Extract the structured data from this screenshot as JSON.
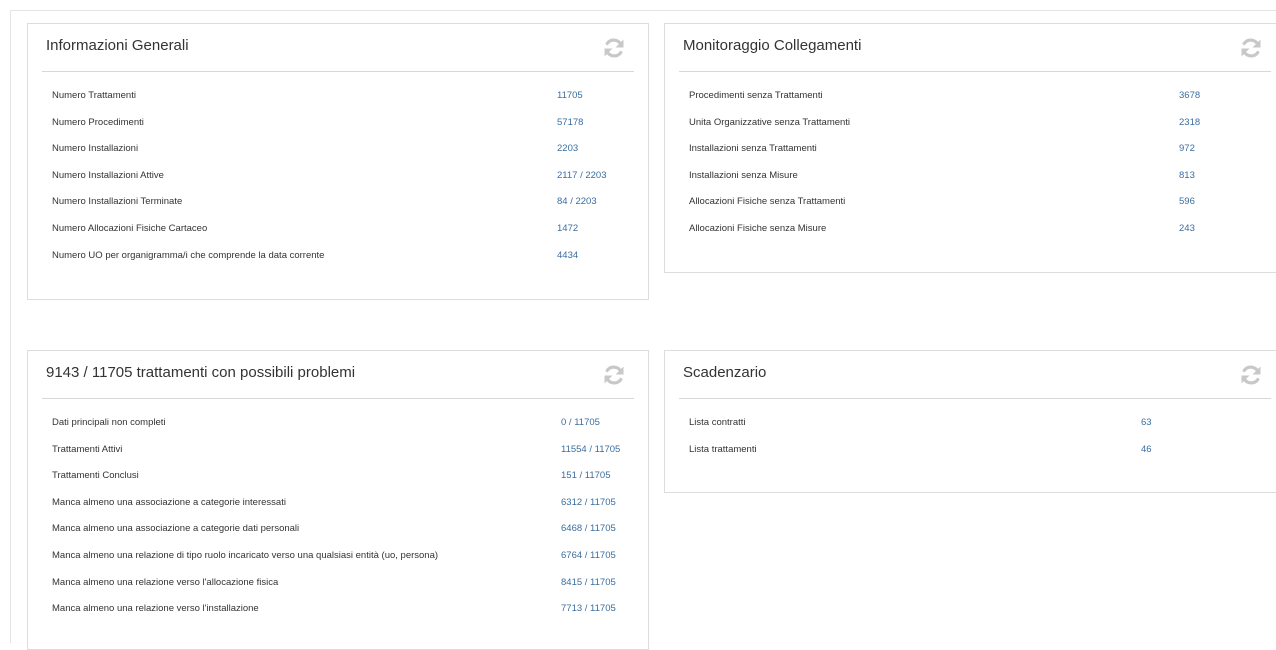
{
  "panels": {
    "info": {
      "title": "Informazioni Generali",
      "rows": [
        {
          "label": "Numero Trattamenti",
          "value": "11705"
        },
        {
          "label": "Numero Procedimenti",
          "value": "57178"
        },
        {
          "label": "Numero Installazioni",
          "value": "2203"
        },
        {
          "label": "Numero Installazioni Attive",
          "value": "2117 / 2203"
        },
        {
          "label": "Numero Installazioni Terminate",
          "value": "84 / 2203"
        },
        {
          "label": "Numero Allocazioni Fisiche Cartaceo",
          "value": "1472"
        },
        {
          "label": "Numero UO per organigramma/i che comprende la data corrente",
          "value": "4434"
        }
      ]
    },
    "monitor": {
      "title": "Monitoraggio Collegamenti",
      "rows": [
        {
          "label": "Procedimenti senza Trattamenti",
          "value": "3678"
        },
        {
          "label": "Unita Organizzative senza Trattamenti",
          "value": "2318"
        },
        {
          "label": "Installazioni senza Trattamenti",
          "value": "972"
        },
        {
          "label": "Installazioni senza Misure",
          "value": "813"
        },
        {
          "label": "Allocazioni Fisiche senza Trattamenti",
          "value": "596"
        },
        {
          "label": "Allocazioni Fisiche senza Misure",
          "value": "243"
        }
      ]
    },
    "problems": {
      "title": "9143 / 11705 trattamenti con possibili problemi",
      "rows": [
        {
          "label": "Dati principali non completi",
          "value": "0 / 11705"
        },
        {
          "label": "Trattamenti Attivi",
          "value": "11554 / 11705"
        },
        {
          "label": "Trattamenti Conclusi",
          "value": "151 / 11705"
        },
        {
          "label": "Manca almeno una associazione a categorie interessati",
          "value": "6312 / 11705"
        },
        {
          "label": "Manca almeno una associazione a categorie dati personali",
          "value": "6468 / 11705"
        },
        {
          "label": "Manca almeno una relazione di tipo ruolo incaricato verso una qualsiasi entità (uo, persona)",
          "value": "6764 / 11705"
        },
        {
          "label": "Manca almeno una relazione verso l'allocazione fisica",
          "value": "8415 / 11705"
        },
        {
          "label": "Manca almeno una relazione verso l'installazione",
          "value": "7713 / 11705"
        }
      ]
    },
    "schedule": {
      "title": "Scadenzario",
      "rows": [
        {
          "label": "Lista contratti",
          "value": "63"
        },
        {
          "label": "Lista trattamenti",
          "value": "46"
        }
      ]
    }
  },
  "colors": {
    "value_link": "#3a6da0",
    "icon": "#c8c8c8",
    "border": "#dddddd"
  },
  "icons": {
    "refresh": "refresh-icon"
  }
}
